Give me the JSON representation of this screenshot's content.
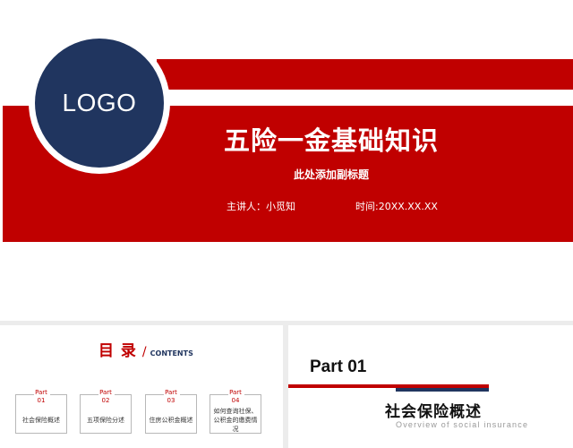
{
  "cover": {
    "logo": "LOGO",
    "title": "五险一金基础知识",
    "subtitle": "此处添加副标题",
    "presenter": "主讲人：小觅知",
    "time": "时间:20XX.XX.XX"
  },
  "toc": {
    "title": "目 录",
    "slash": "/",
    "contents": "CONTENTS",
    "items": [
      {
        "part": "Part",
        "num": "01",
        "name": "社会保险概述"
      },
      {
        "part": "Part",
        "num": "02",
        "name": "五项保险分述"
      },
      {
        "part": "Part",
        "num": "03",
        "name": "住房公积金概述"
      },
      {
        "part": "Part",
        "num": "04",
        "name": "如何查询社保、公积金的缴费情况"
      }
    ]
  },
  "section": {
    "part": "Part 01",
    "title": "社会保险概述",
    "subtitle": "Overview of social insurance"
  },
  "colors": {
    "brand_red": "#c00000",
    "brand_navy": "#20355f"
  }
}
